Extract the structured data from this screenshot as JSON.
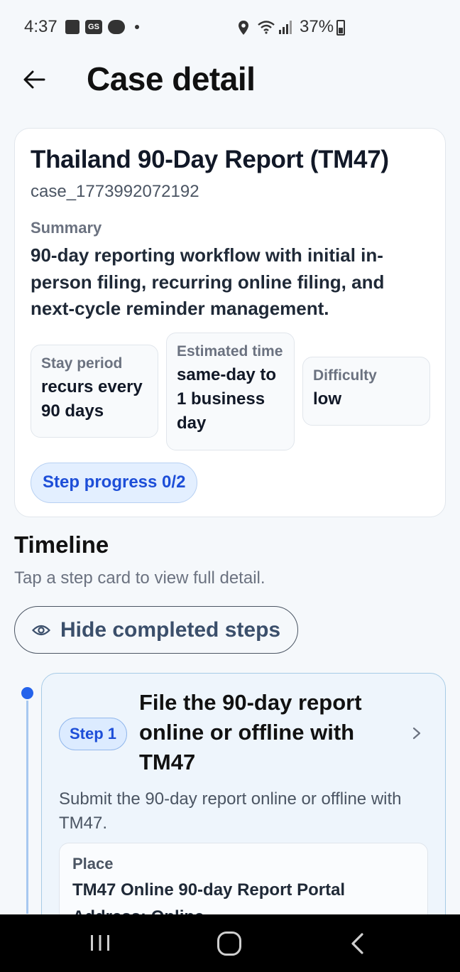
{
  "status_bar": {
    "time": "4:37",
    "gs_badge": "GS",
    "battery": "37%"
  },
  "header": {
    "title": "Case detail"
  },
  "case": {
    "title": "Thailand 90-Day Report (TM47)",
    "id": "case_1773992072192",
    "summary_label": "Summary",
    "summary": "90-day reporting workflow with initial in-person filing, recurring online filing, and next-cycle reminder management.",
    "stats": [
      {
        "label": "Stay period",
        "value": "recurs every 90 days"
      },
      {
        "label": "Estimated time",
        "value": "same-day to 1 business day"
      },
      {
        "label": "Difficulty",
        "value": "low"
      }
    ],
    "progress": "Step progress 0/2"
  },
  "timeline": {
    "heading": "Timeline",
    "hint": "Tap a step card to view full detail.",
    "toggle_label": "Hide completed steps",
    "steps": [
      {
        "badge": "Step 1",
        "title": "File the 90-day report online or offline with TM47",
        "description": "Submit the 90-day report online or offline with TM47.",
        "place_label": "Place",
        "place_value": "TM47 Online 90-day Report Portal",
        "place_sub": "Address: Online"
      }
    ]
  },
  "colors": {
    "accent": "#1d4ed8",
    "timeline_dot": "#2563eb",
    "card_bg": "#ffffff",
    "step_card_bg": "#eef5fc"
  }
}
